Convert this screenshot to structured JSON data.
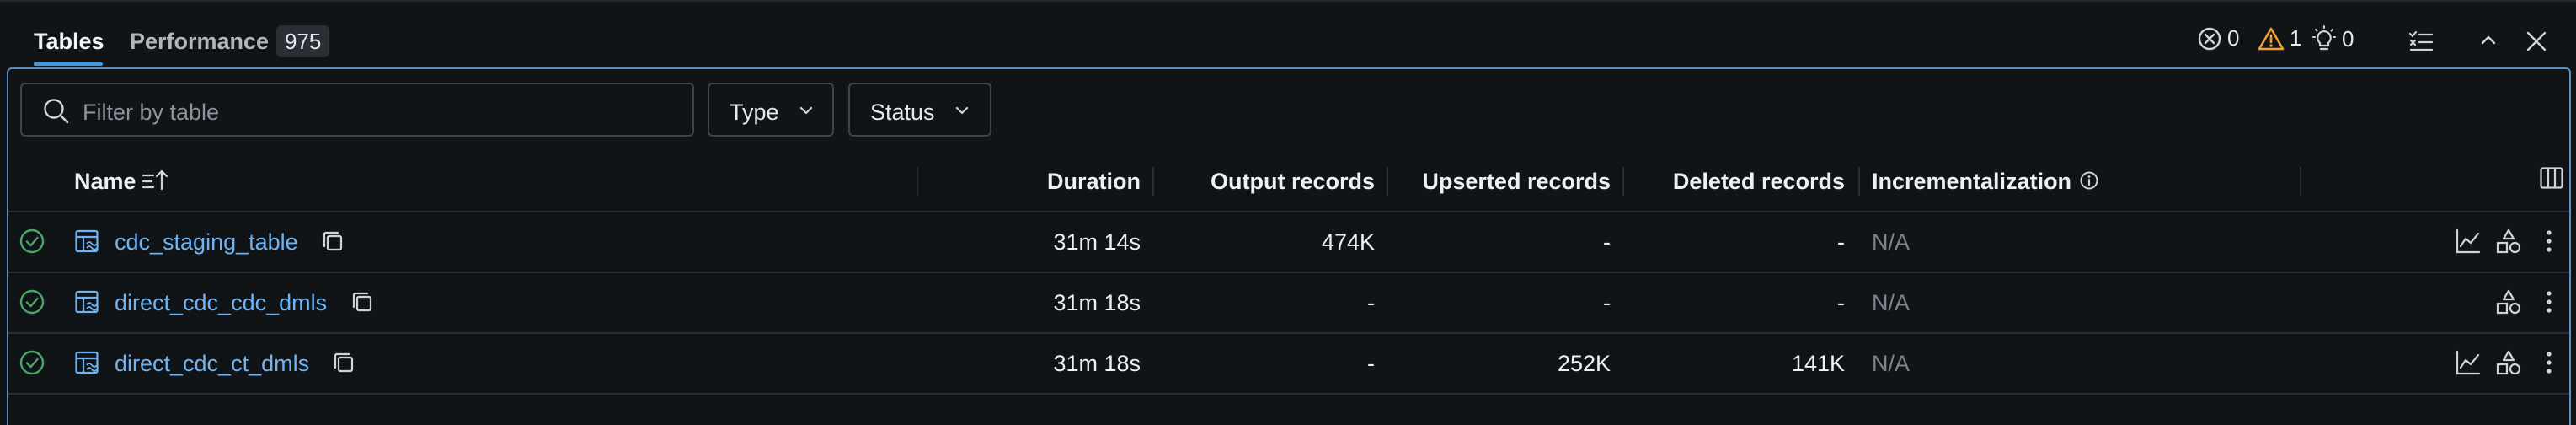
{
  "tabs": {
    "tables": "Tables",
    "performance": "Performance",
    "performance_count": "975"
  },
  "status_counts": {
    "errors": "0",
    "warnings": "1",
    "suggestions": "0"
  },
  "filters": {
    "search_placeholder": "Filter by table",
    "type_label": "Type",
    "status_label": "Status"
  },
  "table": {
    "headers": {
      "name": "Name",
      "duration": "Duration",
      "output_records": "Output records",
      "upserted_records": "Upserted records",
      "deleted_records": "Deleted records",
      "incrementalization": "Incrementalization"
    },
    "rows": [
      {
        "name": "cdc_staging_table",
        "duration": "31m 14s",
        "output_records": "474K",
        "upserted_records": "-",
        "deleted_records": "-",
        "incrementalization": "N/A"
      },
      {
        "name": "direct_cdc_cdc_dmls",
        "duration": "31m 18s",
        "output_records": "-",
        "upserted_records": "-",
        "deleted_records": "-",
        "incrementalization": "N/A"
      },
      {
        "name": "direct_cdc_ct_dmls",
        "duration": "31m 18s",
        "output_records": "-",
        "upserted_records": "252K",
        "deleted_records": "141K",
        "incrementalization": "N/A"
      }
    ]
  },
  "colors": {
    "accent": "#4299e1",
    "success": "#48a868",
    "warning": "#f0a030",
    "link": "#6fb3f2"
  }
}
